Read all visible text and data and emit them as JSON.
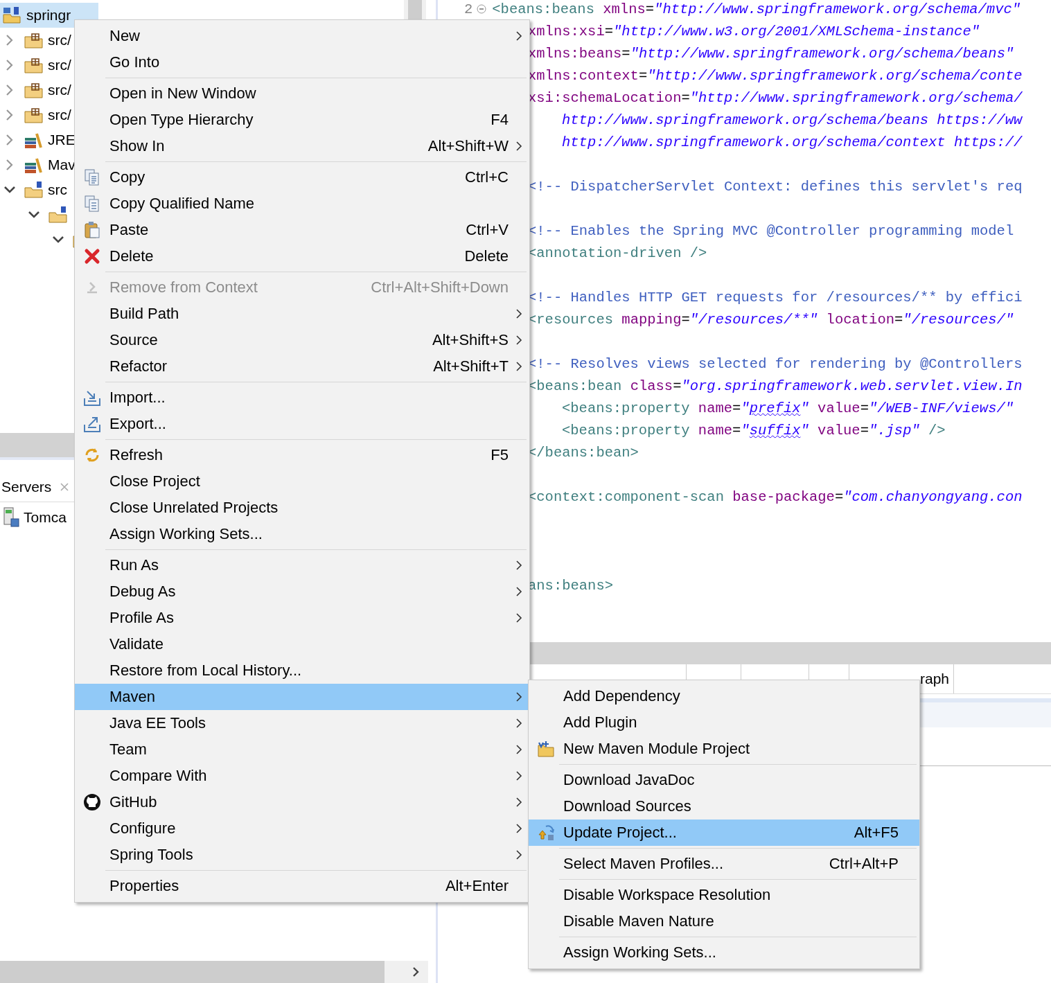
{
  "tree": {
    "items": [
      {
        "label": "springr",
        "kind": "project",
        "selected": true,
        "children": [
          {
            "label": "src/",
            "kind": "package",
            "expanded": false,
            "selected": false
          },
          {
            "label": "src/",
            "kind": "package",
            "expanded": false,
            "selected": false
          },
          {
            "label": "src/",
            "kind": "package",
            "expanded": false,
            "selected": false
          },
          {
            "label": "src/",
            "kind": "package",
            "expanded": false,
            "selected": false
          },
          {
            "label": "JRE",
            "kind": "library",
            "expanded": false,
            "selected": false
          },
          {
            "label": "Mav",
            "kind": "library",
            "expanded": false,
            "selected": false
          },
          {
            "label": "src",
            "kind": "source",
            "expanded": true,
            "selected": false,
            "children": [
              {
                "kind": "source",
                "expanded": true,
                "selected": false,
                "children": [
                  {
                    "kind": "folder",
                    "expanded": true,
                    "selected": false
                  }
                ]
              }
            ]
          }
        ]
      }
    ]
  },
  "servers_panel": {
    "tab": "Servers",
    "items": [
      {
        "label": "Tomca"
      }
    ]
  },
  "editor": {
    "lines": [
      {
        "kind": "head",
        "line_number": "2",
        "tokens": [
          {
            "kind": "tag",
            "text": "<beans:beans "
          },
          {
            "kind": "attr",
            "text": "xmlns"
          },
          {
            "kind": "plain",
            "text": "="
          },
          {
            "kind": "value",
            "text": "\"http://www.springframework.org/schema/mvc\""
          }
        ]
      },
      {
        "kind": "code",
        "indented": false,
        "tokens": [
          {
            "kind": "attr",
            "text": "xmlns:xsi"
          },
          {
            "kind": "plain",
            "text": "="
          },
          {
            "kind": "value",
            "text": "\"http://www.w3.org/2001/XMLSchema-instance\""
          }
        ]
      },
      {
        "kind": "code",
        "indented": false,
        "tokens": [
          {
            "kind": "attr",
            "text": "xmlns:beans"
          },
          {
            "kind": "plain",
            "text": "="
          },
          {
            "kind": "value",
            "text": "\"http://www.springframework.org/schema/beans\""
          }
        ]
      },
      {
        "kind": "code",
        "indented": false,
        "tokens": [
          {
            "kind": "attr",
            "text": "xmlns:context"
          },
          {
            "kind": "plain",
            "text": "="
          },
          {
            "kind": "value",
            "text": "\"http://www.springframework.org/schema/conte"
          }
        ]
      },
      {
        "kind": "code",
        "indented": false,
        "tokens": [
          {
            "kind": "attr",
            "text": "xsi:schemaLocation"
          },
          {
            "kind": "plain",
            "text": "="
          },
          {
            "kind": "value",
            "text": "\"http://www.springframework.org/schema/"
          }
        ]
      },
      {
        "kind": "code",
        "indented": true,
        "tokens": [
          {
            "kind": "value",
            "text": "http://www.springframework.org/schema/beans https://ww"
          }
        ]
      },
      {
        "kind": "code",
        "indented": true,
        "tokens": [
          {
            "kind": "value",
            "text": "http://www.springframework.org/schema/context https://"
          }
        ]
      },
      {
        "kind": "blank"
      },
      {
        "kind": "code",
        "indented": false,
        "tokens": [
          {
            "kind": "comment",
            "text": "<!-- DispatcherServlet Context: defines this servlet's req"
          }
        ]
      },
      {
        "kind": "blank"
      },
      {
        "kind": "code",
        "indented": false,
        "tokens": [
          {
            "kind": "comment",
            "text": "<!-- Enables the Spring MVC @Controller programming model"
          }
        ]
      },
      {
        "kind": "code",
        "indented": false,
        "tokens": [
          {
            "kind": "tag",
            "text": "<annotation-driven />"
          }
        ]
      },
      {
        "kind": "blank"
      },
      {
        "kind": "code",
        "indented": false,
        "tokens": [
          {
            "kind": "comment",
            "text": "<!-- Handles HTTP GET requests for /resources/** by effici"
          }
        ]
      },
      {
        "kind": "code",
        "indented": false,
        "tokens": [
          {
            "kind": "tag",
            "text": "<resources "
          },
          {
            "kind": "attr",
            "text": "mapping"
          },
          {
            "kind": "plain",
            "text": "="
          },
          {
            "kind": "value",
            "text": "\"/resources/**\" "
          },
          {
            "kind": "attr",
            "text": "location"
          },
          {
            "kind": "plain",
            "text": "="
          },
          {
            "kind": "value",
            "text": "\"/resources/\""
          }
        ]
      },
      {
        "kind": "blank"
      },
      {
        "kind": "code",
        "indented": false,
        "tokens": [
          {
            "kind": "comment",
            "text": "<!-- Resolves views selected for rendering by @Controllers"
          }
        ]
      },
      {
        "kind": "code",
        "indented": false,
        "tokens": [
          {
            "kind": "tag",
            "text": "<beans:bean "
          },
          {
            "kind": "attr",
            "text": "class"
          },
          {
            "kind": "plain",
            "text": "="
          },
          {
            "kind": "value",
            "text": "\"org.springframework.web.servlet.view.In"
          }
        ]
      },
      {
        "kind": "code",
        "indented": true,
        "tokens": [
          {
            "kind": "tag",
            "text": "<beans:property "
          },
          {
            "kind": "attr",
            "text": "name"
          },
          {
            "kind": "plain",
            "text": "="
          },
          {
            "kind": "value",
            "text": "\""
          },
          {
            "kind": "typo",
            "text": "prefix"
          },
          {
            "kind": "value",
            "text": "\" "
          },
          {
            "kind": "attr",
            "text": "value"
          },
          {
            "kind": "plain",
            "text": "="
          },
          {
            "kind": "value",
            "text": "\"/WEB-INF/views/\""
          }
        ]
      },
      {
        "kind": "code",
        "indented": true,
        "tokens": [
          {
            "kind": "tag",
            "text": "<beans:property "
          },
          {
            "kind": "attr",
            "text": "name"
          },
          {
            "kind": "plain",
            "text": "="
          },
          {
            "kind": "value",
            "text": "\""
          },
          {
            "kind": "typo",
            "text": "suffix"
          },
          {
            "kind": "value",
            "text": "\" "
          },
          {
            "kind": "attr",
            "text": "value"
          },
          {
            "kind": "plain",
            "text": "="
          },
          {
            "kind": "value",
            "text": "\".jsp\" "
          },
          {
            "kind": "tag",
            "text": "/>"
          }
        ]
      },
      {
        "kind": "code",
        "indented": false,
        "tokens": [
          {
            "kind": "tag",
            "text": "</beans:bean>"
          }
        ]
      },
      {
        "kind": "blank"
      },
      {
        "kind": "code",
        "indented": false,
        "tokens": [
          {
            "kind": "tag",
            "text": "<context:component-scan "
          },
          {
            "kind": "attr",
            "text": "base-package"
          },
          {
            "kind": "plain",
            "text": "="
          },
          {
            "kind": "value",
            "text": "\"com.chanyongyang.con"
          }
        ]
      },
      {
        "kind": "blank"
      },
      {
        "kind": "blank"
      },
      {
        "kind": "blank"
      },
      {
        "kind": "code",
        "indented": false,
        "tokens": [
          {
            "kind": "tag",
            "text": "ans:beans>"
          }
        ]
      }
    ]
  },
  "bottom_tabs": [
    {
      "label": "raph"
    }
  ],
  "context_menu": {
    "groups": [
      {
        "items": [
          {
            "label": "New",
            "submenu": true,
            "disabled": false,
            "selected": false
          },
          {
            "label": "Go Into",
            "submenu": false,
            "disabled": false,
            "selected": false
          }
        ]
      },
      {
        "items": [
          {
            "label": "Open in New Window",
            "submenu": false,
            "disabled": false,
            "selected": false
          },
          {
            "label": "Open Type Hierarchy",
            "shortcut": "F4",
            "submenu": false,
            "disabled": false,
            "selected": false
          },
          {
            "label": "Show In",
            "shortcut": "Alt+Shift+W",
            "submenu": true,
            "disabled": false,
            "selected": false
          }
        ]
      },
      {
        "items": [
          {
            "label": "Copy",
            "shortcut": "Ctrl+C",
            "submenu": false,
            "disabled": false,
            "selected": false
          },
          {
            "label": "Copy Qualified Name",
            "submenu": false,
            "disabled": false,
            "selected": false
          },
          {
            "label": "Paste",
            "shortcut": "Ctrl+V",
            "submenu": false,
            "disabled": false,
            "selected": false
          },
          {
            "label": "Delete",
            "shortcut": "Delete",
            "submenu": false,
            "disabled": false,
            "selected": false
          }
        ]
      },
      {
        "items": [
          {
            "label": "Remove from Context",
            "shortcut": "Ctrl+Alt+Shift+Down",
            "submenu": false,
            "disabled": true,
            "selected": false
          },
          {
            "label": "Build Path",
            "submenu": true,
            "disabled": false,
            "selected": false
          },
          {
            "label": "Source",
            "shortcut": "Alt+Shift+S",
            "submenu": true,
            "disabled": false,
            "selected": false
          },
          {
            "label": "Refactor",
            "shortcut": "Alt+Shift+T",
            "submenu": true,
            "disabled": false,
            "selected": false
          }
        ]
      },
      {
        "items": [
          {
            "label": "Import...",
            "submenu": false,
            "disabled": false,
            "selected": false
          },
          {
            "label": "Export...",
            "submenu": false,
            "disabled": false,
            "selected": false
          }
        ]
      },
      {
        "items": [
          {
            "label": "Refresh",
            "shortcut": "F5",
            "submenu": false,
            "disabled": false,
            "selected": false
          },
          {
            "label": "Close Project",
            "submenu": false,
            "disabled": false,
            "selected": false
          },
          {
            "label": "Close Unrelated Projects",
            "submenu": false,
            "disabled": false,
            "selected": false
          },
          {
            "label": "Assign Working Sets...",
            "submenu": false,
            "disabled": false,
            "selected": false
          }
        ]
      },
      {
        "items": [
          {
            "label": "Run As",
            "submenu": true,
            "disabled": false,
            "selected": false
          },
          {
            "label": "Debug As",
            "submenu": true,
            "disabled": false,
            "selected": false
          },
          {
            "label": "Profile As",
            "submenu": true,
            "disabled": false,
            "selected": false
          },
          {
            "label": "Validate",
            "submenu": false,
            "disabled": false,
            "selected": false
          },
          {
            "label": "Restore from Local History...",
            "submenu": false,
            "disabled": false,
            "selected": false
          },
          {
            "label": "Maven",
            "submenu": true,
            "disabled": false,
            "selected": true
          },
          {
            "label": "Java EE Tools",
            "submenu": true,
            "disabled": false,
            "selected": false
          },
          {
            "label": "Team",
            "submenu": true,
            "disabled": false,
            "selected": false
          },
          {
            "label": "Compare With",
            "submenu": true,
            "disabled": false,
            "selected": false
          },
          {
            "label": "GitHub",
            "submenu": true,
            "disabled": false,
            "selected": false
          },
          {
            "label": "Configure",
            "submenu": true,
            "disabled": false,
            "selected": false
          },
          {
            "label": "Spring Tools",
            "submenu": true,
            "disabled": false,
            "selected": false
          }
        ]
      },
      {
        "items": [
          {
            "label": "Properties",
            "shortcut": "Alt+Enter",
            "submenu": false,
            "disabled": false,
            "selected": false
          }
        ]
      }
    ]
  },
  "maven_submenu": {
    "groups": [
      {
        "items": [
          {
            "label": "Add Dependency",
            "selected": false
          },
          {
            "label": "Add Plugin",
            "selected": false
          },
          {
            "label": "New Maven Module Project",
            "selected": false
          }
        ]
      },
      {
        "items": [
          {
            "label": "Download JavaDoc",
            "selected": false
          },
          {
            "label": "Download Sources",
            "selected": false
          },
          {
            "label": "Update Project...",
            "shortcut": "Alt+F5",
            "selected": true
          }
        ]
      },
      {
        "items": [
          {
            "label": "Select Maven Profiles...",
            "shortcut": "Ctrl+Alt+P",
            "selected": false
          }
        ]
      },
      {
        "items": [
          {
            "label": "Disable Workspace Resolution",
            "selected": false
          },
          {
            "label": "Disable Maven Nature",
            "selected": false
          }
        ]
      },
      {
        "items": [
          {
            "label": "Assign Working Sets...",
            "selected": false
          }
        ]
      }
    ]
  }
}
